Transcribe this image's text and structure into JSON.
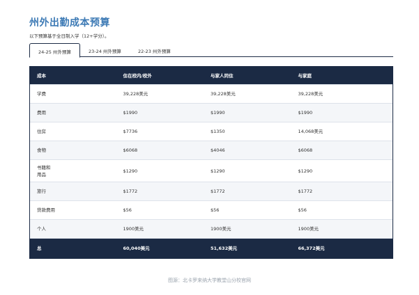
{
  "page": {
    "title": "州外出勤成本预算",
    "subtitle": "以下预算基于全日制入学（12+学分）。"
  },
  "tabs": [
    {
      "label": "24-25 州外预算",
      "active": true
    },
    {
      "label": "23-24 州外预算",
      "active": false
    },
    {
      "label": "22-23 州外预算",
      "active": false
    }
  ],
  "table": {
    "headers": [
      "成本",
      "住在校内/校外",
      "与家人同住",
      "与家庭"
    ],
    "rows": [
      {
        "label": "学费",
        "values": [
          "39,228美元",
          "39,228美元",
          "39,228美元"
        ]
      },
      {
        "label": "费用",
        "values": [
          "$1990",
          "$1990",
          "$1990"
        ]
      },
      {
        "label": "住房",
        "values": [
          "$7736",
          "$1350",
          "14,068美元"
        ]
      },
      {
        "label": "食物",
        "values": [
          "$6068",
          "$4046",
          "$6068"
        ]
      },
      {
        "label": "书籍和\n用品",
        "values": [
          "$1290",
          "$1290",
          "$1290"
        ]
      },
      {
        "label": "旅行",
        "values": [
          "$1772",
          "$1772",
          "$1772"
        ]
      },
      {
        "label": "贷款费用",
        "values": [
          "$56",
          "$56",
          "$56"
        ]
      },
      {
        "label": "个人",
        "values": [
          "1900美元",
          "1900美元",
          "1900美元"
        ]
      }
    ],
    "total": {
      "label": "总",
      "values": [
        "60,040美元",
        "51,632美元",
        "66,372美元"
      ]
    }
  },
  "caption": "图源：北卡罗来纳大学教堂山分校官网",
  "colors": {
    "title": "#3d7ab5",
    "header_bg": "#1b2a44",
    "caption": "#9aa3ad"
  }
}
